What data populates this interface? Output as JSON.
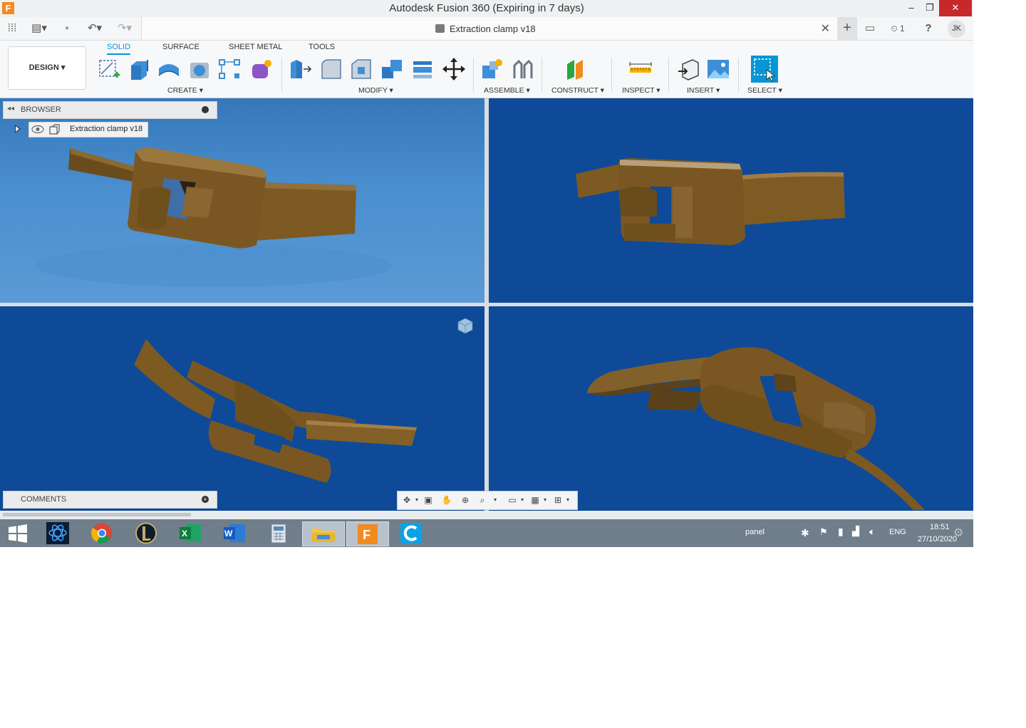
{
  "window": {
    "title": "Autodesk Fusion 360 (Expiring in 7 days)",
    "app_icon_letter": "F",
    "min": "–",
    "max": "❐",
    "close": "✕"
  },
  "quick_access": {
    "grid": "⁞⁞⁞",
    "file": "▤▾",
    "save": "▪",
    "undo": "↶▾",
    "redo": "↷▾",
    "doc_title": "Extraction clamp v18",
    "doc_close": "✕",
    "new_tab": "+",
    "notif": "▭",
    "jobs": "⏲ 1",
    "help": "?",
    "user": "JK"
  },
  "workspace": {
    "label": "DESIGN ▾"
  },
  "tabs": [
    {
      "label": "SOLID",
      "active": true
    },
    {
      "label": "SURFACE"
    },
    {
      "label": "SHEET METAL"
    },
    {
      "label": "TOOLS"
    }
  ],
  "groups": {
    "create": "CREATE ▾",
    "modify": "MODIFY ▾",
    "assemble": "ASSEMBLE ▾",
    "construct": "CONSTRUCT ▾",
    "inspect": "INSPECT ▾",
    "insert": "INSERT ▾",
    "select": "SELECT ▾"
  },
  "browser": {
    "label": "BROWSER",
    "collapse": "◂◂",
    "node_label": "Extraction clamp v18"
  },
  "comments": {
    "label": "COMMENTS",
    "plus": "+"
  },
  "model": {
    "color": "#7c5a22",
    "viewport_color": "#0e4a98"
  },
  "taskbar": {
    "tray_panel": "panel",
    "lang": "ENG",
    "time": "18:51",
    "date": "27/10/2020"
  }
}
